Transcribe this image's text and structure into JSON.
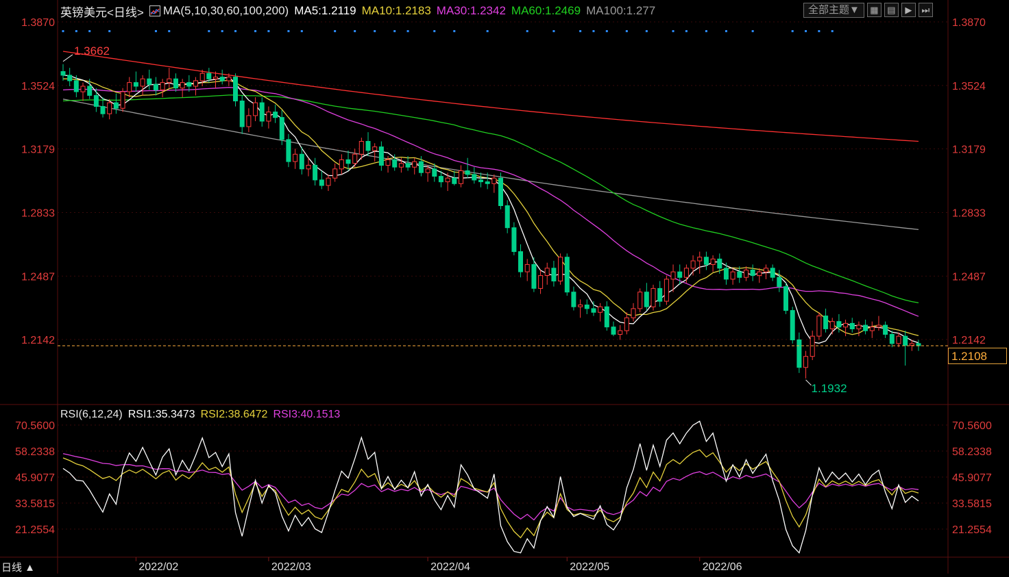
{
  "header": {
    "symbol": "英镑美元",
    "period_tag": "<日线>",
    "ma_set": "MA(5,10,30,60,100,200)",
    "ma5": "MA5:1.2119",
    "ma10": "MA10:1.2183",
    "ma30": "MA30:1.2342",
    "ma60": "MA60:1.2469",
    "ma100": "MA100:1.277"
  },
  "toolbar": {
    "theme_label": "全部主题▼",
    "icons": [
      "grid-icon",
      "layout-icon",
      "play-icon",
      "next-icon"
    ]
  },
  "price_axis": {
    "ticks": [
      "1.3870",
      "1.3524",
      "1.3179",
      "1.2833",
      "1.2487",
      "1.2142"
    ],
    "current_price": "1.2108",
    "max_label": "1.3662",
    "min_label": "1.1932"
  },
  "rsi": {
    "label": "RSI(6,12,24)",
    "rsi1": "RSI1:35.3473",
    "rsi2": "RSI2:38.6472",
    "rsi3": "RSI3:40.1513",
    "ticks": [
      "70.5600",
      "58.2338",
      "45.9077",
      "33.5815",
      "21.2554"
    ]
  },
  "time_axis": {
    "months": [
      "2022/02",
      "2022/03",
      "2022/04",
      "2022/05",
      "2022/06"
    ]
  },
  "footer": {
    "period_label": "日线 ▲"
  },
  "colors": {
    "up": "#ff3b3b",
    "down": "#00d08a",
    "ma5": "#ffffff",
    "ma10": "#e6d23c",
    "ma30": "#e040e0",
    "ma60": "#20d020",
    "ma100": "#9a9a9a",
    "ma200": "#ff3030",
    "axis_text": "#e23c3c",
    "grid": "#3a0a0a",
    "current": "#ffae3c"
  },
  "chart_data": {
    "type": "candlestick",
    "price_range": [
      1.18,
      1.39
    ],
    "candles": [
      {
        "o": 1.36,
        "h": 1.364,
        "l": 1.355,
        "c": 1.358
      },
      {
        "o": 1.358,
        "h": 1.362,
        "l": 1.352,
        "c": 1.355
      },
      {
        "o": 1.355,
        "h": 1.358,
        "l": 1.346,
        "c": 1.349
      },
      {
        "o": 1.349,
        "h": 1.354,
        "l": 1.344,
        "c": 1.352
      },
      {
        "o": 1.352,
        "h": 1.356,
        "l": 1.345,
        "c": 1.347
      },
      {
        "o": 1.347,
        "h": 1.351,
        "l": 1.338,
        "c": 1.341
      },
      {
        "o": 1.341,
        "h": 1.346,
        "l": 1.335,
        "c": 1.337
      },
      {
        "o": 1.337,
        "h": 1.345,
        "l": 1.334,
        "c": 1.343
      },
      {
        "o": 1.343,
        "h": 1.348,
        "l": 1.337,
        "c": 1.34
      },
      {
        "o": 1.34,
        "h": 1.351,
        "l": 1.338,
        "c": 1.349
      },
      {
        "o": 1.349,
        "h": 1.357,
        "l": 1.346,
        "c": 1.354
      },
      {
        "o": 1.354,
        "h": 1.36,
        "l": 1.349,
        "c": 1.352
      },
      {
        "o": 1.352,
        "h": 1.358,
        "l": 1.347,
        "c": 1.356
      },
      {
        "o": 1.356,
        "h": 1.361,
        "l": 1.35,
        "c": 1.353
      },
      {
        "o": 1.353,
        "h": 1.357,
        "l": 1.347,
        "c": 1.35
      },
      {
        "o": 1.35,
        "h": 1.356,
        "l": 1.346,
        "c": 1.354
      },
      {
        "o": 1.354,
        "h": 1.362,
        "l": 1.351,
        "c": 1.356
      },
      {
        "o": 1.356,
        "h": 1.359,
        "l": 1.349,
        "c": 1.351
      },
      {
        "o": 1.351,
        "h": 1.356,
        "l": 1.346,
        "c": 1.354
      },
      {
        "o": 1.354,
        "h": 1.358,
        "l": 1.349,
        "c": 1.352
      },
      {
        "o": 1.352,
        "h": 1.357,
        "l": 1.347,
        "c": 1.355
      },
      {
        "o": 1.355,
        "h": 1.361,
        "l": 1.352,
        "c": 1.359
      },
      {
        "o": 1.359,
        "h": 1.362,
        "l": 1.354,
        "c": 1.356
      },
      {
        "o": 1.356,
        "h": 1.36,
        "l": 1.351,
        "c": 1.357
      },
      {
        "o": 1.357,
        "h": 1.361,
        "l": 1.353,
        "c": 1.355
      },
      {
        "o": 1.355,
        "h": 1.359,
        "l": 1.352,
        "c": 1.357
      },
      {
        "o": 1.357,
        "h": 1.359,
        "l": 1.341,
        "c": 1.344
      },
      {
        "o": 1.344,
        "h": 1.347,
        "l": 1.326,
        "c": 1.33
      },
      {
        "o": 1.33,
        "h": 1.34,
        "l": 1.327,
        "c": 1.336
      },
      {
        "o": 1.336,
        "h": 1.346,
        "l": 1.333,
        "c": 1.343
      },
      {
        "o": 1.343,
        "h": 1.346,
        "l": 1.33,
        "c": 1.333
      },
      {
        "o": 1.333,
        "h": 1.341,
        "l": 1.329,
        "c": 1.338
      },
      {
        "o": 1.338,
        "h": 1.342,
        "l": 1.332,
        "c": 1.335
      },
      {
        "o": 1.335,
        "h": 1.339,
        "l": 1.32,
        "c": 1.323
      },
      {
        "o": 1.323,
        "h": 1.326,
        "l": 1.308,
        "c": 1.311
      },
      {
        "o": 1.311,
        "h": 1.318,
        "l": 1.307,
        "c": 1.315
      },
      {
        "o": 1.315,
        "h": 1.319,
        "l": 1.304,
        "c": 1.307
      },
      {
        "o": 1.307,
        "h": 1.313,
        "l": 1.303,
        "c": 1.309
      },
      {
        "o": 1.309,
        "h": 1.313,
        "l": 1.298,
        "c": 1.301
      },
      {
        "o": 1.301,
        "h": 1.306,
        "l": 1.296,
        "c": 1.298
      },
      {
        "o": 1.298,
        "h": 1.304,
        "l": 1.295,
        "c": 1.302
      },
      {
        "o": 1.302,
        "h": 1.31,
        "l": 1.3,
        "c": 1.307
      },
      {
        "o": 1.307,
        "h": 1.315,
        "l": 1.304,
        "c": 1.312
      },
      {
        "o": 1.312,
        "h": 1.317,
        "l": 1.306,
        "c": 1.31
      },
      {
        "o": 1.31,
        "h": 1.318,
        "l": 1.308,
        "c": 1.315
      },
      {
        "o": 1.315,
        "h": 1.324,
        "l": 1.312,
        "c": 1.322
      },
      {
        "o": 1.322,
        "h": 1.327,
        "l": 1.314,
        "c": 1.317
      },
      {
        "o": 1.317,
        "h": 1.321,
        "l": 1.311,
        "c": 1.319
      },
      {
        "o": 1.319,
        "h": 1.322,
        "l": 1.306,
        "c": 1.309
      },
      {
        "o": 1.309,
        "h": 1.314,
        "l": 1.305,
        "c": 1.312
      },
      {
        "o": 1.312,
        "h": 1.315,
        "l": 1.306,
        "c": 1.308
      },
      {
        "o": 1.308,
        "h": 1.313,
        "l": 1.305,
        "c": 1.31
      },
      {
        "o": 1.31,
        "h": 1.314,
        "l": 1.306,
        "c": 1.308
      },
      {
        "o": 1.308,
        "h": 1.313,
        "l": 1.304,
        "c": 1.311
      },
      {
        "o": 1.311,
        "h": 1.314,
        "l": 1.303,
        "c": 1.305
      },
      {
        "o": 1.305,
        "h": 1.309,
        "l": 1.3,
        "c": 1.307
      },
      {
        "o": 1.307,
        "h": 1.31,
        "l": 1.3,
        "c": 1.303
      },
      {
        "o": 1.303,
        "h": 1.306,
        "l": 1.297,
        "c": 1.3
      },
      {
        "o": 1.3,
        "h": 1.305,
        "l": 1.295,
        "c": 1.302
      },
      {
        "o": 1.302,
        "h": 1.306,
        "l": 1.298,
        "c": 1.299
      },
      {
        "o": 1.299,
        "h": 1.309,
        "l": 1.297,
        "c": 1.306
      },
      {
        "o": 1.306,
        "h": 1.313,
        "l": 1.302,
        "c": 1.304
      },
      {
        "o": 1.304,
        "h": 1.308,
        "l": 1.299,
        "c": 1.301
      },
      {
        "o": 1.301,
        "h": 1.305,
        "l": 1.297,
        "c": 1.3
      },
      {
        "o": 1.3,
        "h": 1.305,
        "l": 1.296,
        "c": 1.299
      },
      {
        "o": 1.299,
        "h": 1.304,
        "l": 1.294,
        "c": 1.302
      },
      {
        "o": 1.302,
        "h": 1.305,
        "l": 1.285,
        "c": 1.287
      },
      {
        "o": 1.287,
        "h": 1.29,
        "l": 1.272,
        "c": 1.275
      },
      {
        "o": 1.275,
        "h": 1.278,
        "l": 1.26,
        "c": 1.262
      },
      {
        "o": 1.262,
        "h": 1.266,
        "l": 1.248,
        "c": 1.251
      },
      {
        "o": 1.251,
        "h": 1.258,
        "l": 1.246,
        "c": 1.255
      },
      {
        "o": 1.255,
        "h": 1.259,
        "l": 1.24,
        "c": 1.242
      },
      {
        "o": 1.242,
        "h": 1.252,
        "l": 1.239,
        "c": 1.249
      },
      {
        "o": 1.249,
        "h": 1.256,
        "l": 1.244,
        "c": 1.253
      },
      {
        "o": 1.253,
        "h": 1.257,
        "l": 1.243,
        "c": 1.246
      },
      {
        "o": 1.246,
        "h": 1.261,
        "l": 1.244,
        "c": 1.259
      },
      {
        "o": 1.259,
        "h": 1.261,
        "l": 1.238,
        "c": 1.24
      },
      {
        "o": 1.24,
        "h": 1.243,
        "l": 1.23,
        "c": 1.232
      },
      {
        "o": 1.232,
        "h": 1.236,
        "l": 1.226,
        "c": 1.233
      },
      {
        "o": 1.233,
        "h": 1.236,
        "l": 1.228,
        "c": 1.231
      },
      {
        "o": 1.231,
        "h": 1.235,
        "l": 1.227,
        "c": 1.229
      },
      {
        "o": 1.229,
        "h": 1.234,
        "l": 1.224,
        "c": 1.232
      },
      {
        "o": 1.232,
        "h": 1.235,
        "l": 1.219,
        "c": 1.221
      },
      {
        "o": 1.221,
        "h": 1.224,
        "l": 1.216,
        "c": 1.217
      },
      {
        "o": 1.217,
        "h": 1.222,
        "l": 1.214,
        "c": 1.219
      },
      {
        "o": 1.219,
        "h": 1.229,
        "l": 1.217,
        "c": 1.226
      },
      {
        "o": 1.226,
        "h": 1.234,
        "l": 1.224,
        "c": 1.231
      },
      {
        "o": 1.231,
        "h": 1.242,
        "l": 1.229,
        "c": 1.24
      },
      {
        "o": 1.24,
        "h": 1.245,
        "l": 1.23,
        "c": 1.232
      },
      {
        "o": 1.232,
        "h": 1.244,
        "l": 1.23,
        "c": 1.242
      },
      {
        "o": 1.242,
        "h": 1.246,
        "l": 1.232,
        "c": 1.235
      },
      {
        "o": 1.235,
        "h": 1.249,
        "l": 1.233,
        "c": 1.247
      },
      {
        "o": 1.247,
        "h": 1.255,
        "l": 1.24,
        "c": 1.251
      },
      {
        "o": 1.251,
        "h": 1.255,
        "l": 1.244,
        "c": 1.248
      },
      {
        "o": 1.248,
        "h": 1.255,
        "l": 1.245,
        "c": 1.253
      },
      {
        "o": 1.253,
        "h": 1.26,
        "l": 1.249,
        "c": 1.257
      },
      {
        "o": 1.257,
        "h": 1.262,
        "l": 1.25,
        "c": 1.259
      },
      {
        "o": 1.259,
        "h": 1.262,
        "l": 1.252,
        "c": 1.255
      },
      {
        "o": 1.255,
        "h": 1.26,
        "l": 1.251,
        "c": 1.258
      },
      {
        "o": 1.258,
        "h": 1.261,
        "l": 1.25,
        "c": 1.253
      },
      {
        "o": 1.253,
        "h": 1.256,
        "l": 1.244,
        "c": 1.247
      },
      {
        "o": 1.247,
        "h": 1.253,
        "l": 1.244,
        "c": 1.251
      },
      {
        "o": 1.251,
        "h": 1.254,
        "l": 1.245,
        "c": 1.248
      },
      {
        "o": 1.248,
        "h": 1.254,
        "l": 1.246,
        "c": 1.252
      },
      {
        "o": 1.252,
        "h": 1.255,
        "l": 1.246,
        "c": 1.249
      },
      {
        "o": 1.249,
        "h": 1.253,
        "l": 1.245,
        "c": 1.251
      },
      {
        "o": 1.251,
        "h": 1.255,
        "l": 1.247,
        "c": 1.253
      },
      {
        "o": 1.253,
        "h": 1.255,
        "l": 1.246,
        "c": 1.248
      },
      {
        "o": 1.248,
        "h": 1.252,
        "l": 1.24,
        "c": 1.243
      },
      {
        "o": 1.243,
        "h": 1.245,
        "l": 1.228,
        "c": 1.23
      },
      {
        "o": 1.23,
        "h": 1.232,
        "l": 1.212,
        "c": 1.214
      },
      {
        "o": 1.214,
        "h": 1.218,
        "l": 1.196,
        "c": 1.199
      },
      {
        "o": 1.199,
        "h": 1.208,
        "l": 1.193,
        "c": 1.205
      },
      {
        "o": 1.205,
        "h": 1.219,
        "l": 1.203,
        "c": 1.216
      },
      {
        "o": 1.216,
        "h": 1.229,
        "l": 1.214,
        "c": 1.227
      },
      {
        "o": 1.227,
        "h": 1.231,
        "l": 1.218,
        "c": 1.22
      },
      {
        "o": 1.22,
        "h": 1.226,
        "l": 1.217,
        "c": 1.224
      },
      {
        "o": 1.224,
        "h": 1.228,
        "l": 1.218,
        "c": 1.221
      },
      {
        "o": 1.221,
        "h": 1.225,
        "l": 1.216,
        "c": 1.223
      },
      {
        "o": 1.223,
        "h": 1.226,
        "l": 1.218,
        "c": 1.22
      },
      {
        "o": 1.22,
        "h": 1.224,
        "l": 1.216,
        "c": 1.222
      },
      {
        "o": 1.222,
        "h": 1.225,
        "l": 1.217,
        "c": 1.219
      },
      {
        "o": 1.219,
        "h": 1.224,
        "l": 1.215,
        "c": 1.221
      },
      {
        "o": 1.221,
        "h": 1.227,
        "l": 1.219,
        "c": 1.222
      },
      {
        "o": 1.222,
        "h": 1.224,
        "l": 1.215,
        "c": 1.217
      },
      {
        "o": 1.217,
        "h": 1.219,
        "l": 1.21,
        "c": 1.212
      },
      {
        "o": 1.212,
        "h": 1.218,
        "l": 1.21,
        "c": 1.216
      },
      {
        "o": 1.216,
        "h": 1.219,
        "l": 1.2,
        "c": 1.211
      },
      {
        "o": 1.211,
        "h": 1.214,
        "l": 1.208,
        "c": 1.212
      },
      {
        "o": 1.212,
        "h": 1.214,
        "l": 1.208,
        "c": 1.2108
      }
    ],
    "ma200": {
      "start": 1.371,
      "end": 1.322
    },
    "ma100": {
      "start": 1.345,
      "end": 1.274
    },
    "rsi_range": [
      10,
      82
    ],
    "rsi_start_values": {
      "rsi1": 50,
      "rsi2": 55,
      "rsi3": 57
    },
    "month_start_index": [
      11,
      31,
      55,
      76,
      96
    ]
  }
}
